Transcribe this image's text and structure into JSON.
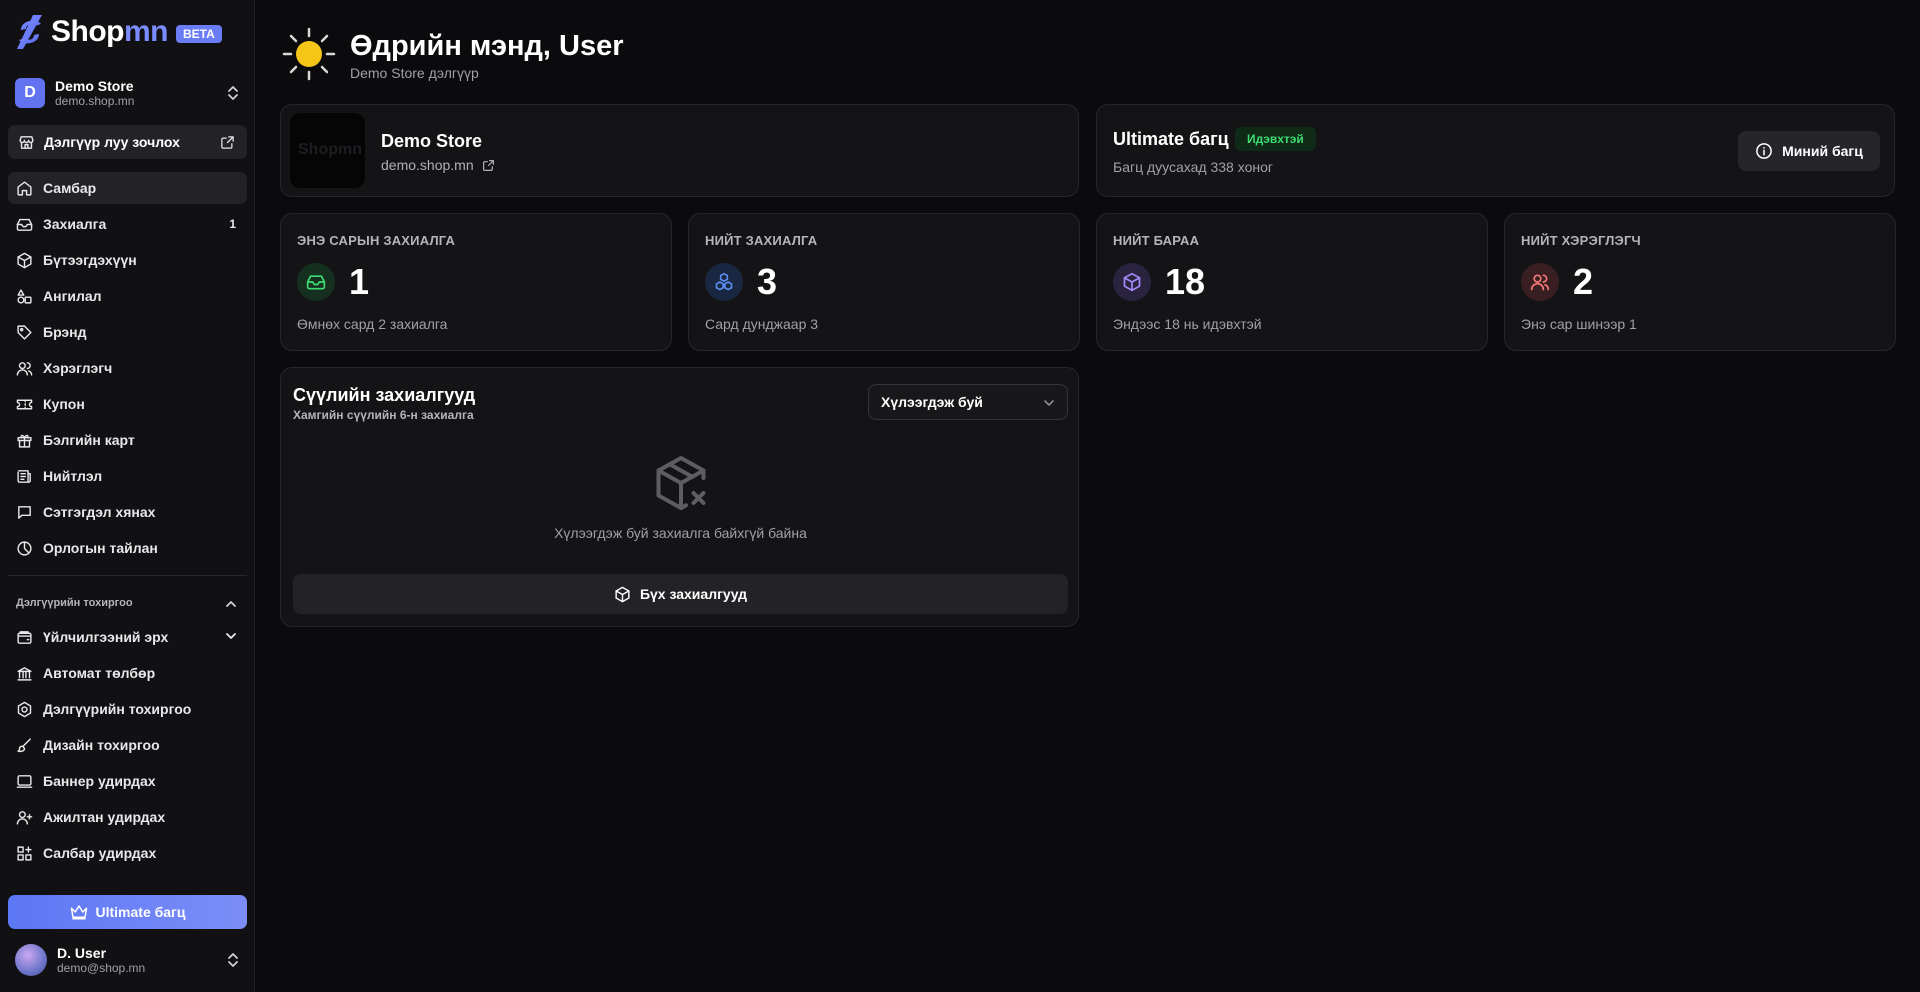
{
  "brand": {
    "name_main": "Shop",
    "name_accent": "mn",
    "badge": "BETA"
  },
  "store": {
    "avatar": "D",
    "name": "Demo Store",
    "domain": "demo.shop.mn"
  },
  "sidebar": {
    "visit_store": "Дэлгүүр луу зочлох",
    "items": [
      {
        "label": "Самбар",
        "icon": "home-icon",
        "active": true
      },
      {
        "label": "Захиалга",
        "icon": "inbox-icon",
        "count": "1"
      },
      {
        "label": "Бүтээгдэхүүн",
        "icon": "package-icon"
      },
      {
        "label": "Ангилал",
        "icon": "shapes-icon"
      },
      {
        "label": "Брэнд",
        "icon": "tag-icon"
      },
      {
        "label": "Хэрэглэгч",
        "icon": "users-icon"
      },
      {
        "label": "Купон",
        "icon": "ticket-icon"
      },
      {
        "label": "Бэлгийн карт",
        "icon": "gift-icon"
      },
      {
        "label": "Нийтлэл",
        "icon": "newspaper-icon"
      },
      {
        "label": "Сэтгэгдэл хянах",
        "icon": "message-icon"
      },
      {
        "label": "Орлогын тайлан",
        "icon": "chart-icon"
      }
    ],
    "section_title": "Дэлгүүрийн тохиргоо",
    "settings_items": [
      {
        "label": "Үйлчилгээний эрх",
        "icon": "wallet-icon",
        "has_chevron": true
      },
      {
        "label": "Автомат төлбөр",
        "icon": "bank-icon"
      },
      {
        "label": "Дэлгүүрийн тохиргоо",
        "icon": "settings-icon"
      },
      {
        "label": "Дизайн тохиргоо",
        "icon": "brush-icon"
      },
      {
        "label": "Баннер удирдах",
        "icon": "monitor-icon"
      },
      {
        "label": "Ажилтан удирдах",
        "icon": "user-plus-icon"
      },
      {
        "label": "Салбар удирдах",
        "icon": "grid-plus-icon"
      }
    ],
    "upgrade": "Ultimate багц"
  },
  "user": {
    "name": "D. User",
    "email": "demo@shop.mn"
  },
  "greeting": {
    "title": "Өдрийн мэнд, User",
    "subtitle": "Demo Store дэлгүүр"
  },
  "store_card": {
    "name": "Demo Store",
    "domain": "demo.shop.mn",
    "thumb_text": "Shopmn"
  },
  "plan_card": {
    "name": "Ultimate багц",
    "status": "Идэвхтэй",
    "remaining": "Багц дуусахад 338 хоног",
    "button": "Миний багц"
  },
  "stats": [
    {
      "label": "ЭНЭ САРЫН ЗАХИАЛГА",
      "value": "1",
      "sub": "Өмнөх сард 2 захиалга",
      "icon": "inbox-icon",
      "color": "#3ddc73"
    },
    {
      "label": "НИЙТ ЗАХИАЛГА",
      "value": "3",
      "sub": "Сард дунджаар 3",
      "icon": "boxes-icon",
      "color": "#5b8def"
    },
    {
      "label": "НИЙТ БАРАА",
      "value": "18",
      "sub": "Эндээс 18 нь идэвхтэй",
      "icon": "package-icon",
      "color": "#a78bfa"
    },
    {
      "label": "НИЙТ ХЭРЭГЛЭГЧ",
      "value": "2",
      "sub": "Энэ сар шинээр 1",
      "icon": "users-icon",
      "color": "#f47a7a"
    }
  ],
  "orders": {
    "title": "Сүүлийн захиалгууд",
    "subtitle": "Хамгийн сүүлийн 6-н захиалга",
    "filter": "Хүлээгдэж буй",
    "empty": "Хүлээгдэж буй захиалга байхгүй байна",
    "all_button": "Бүх захиалгууд"
  }
}
